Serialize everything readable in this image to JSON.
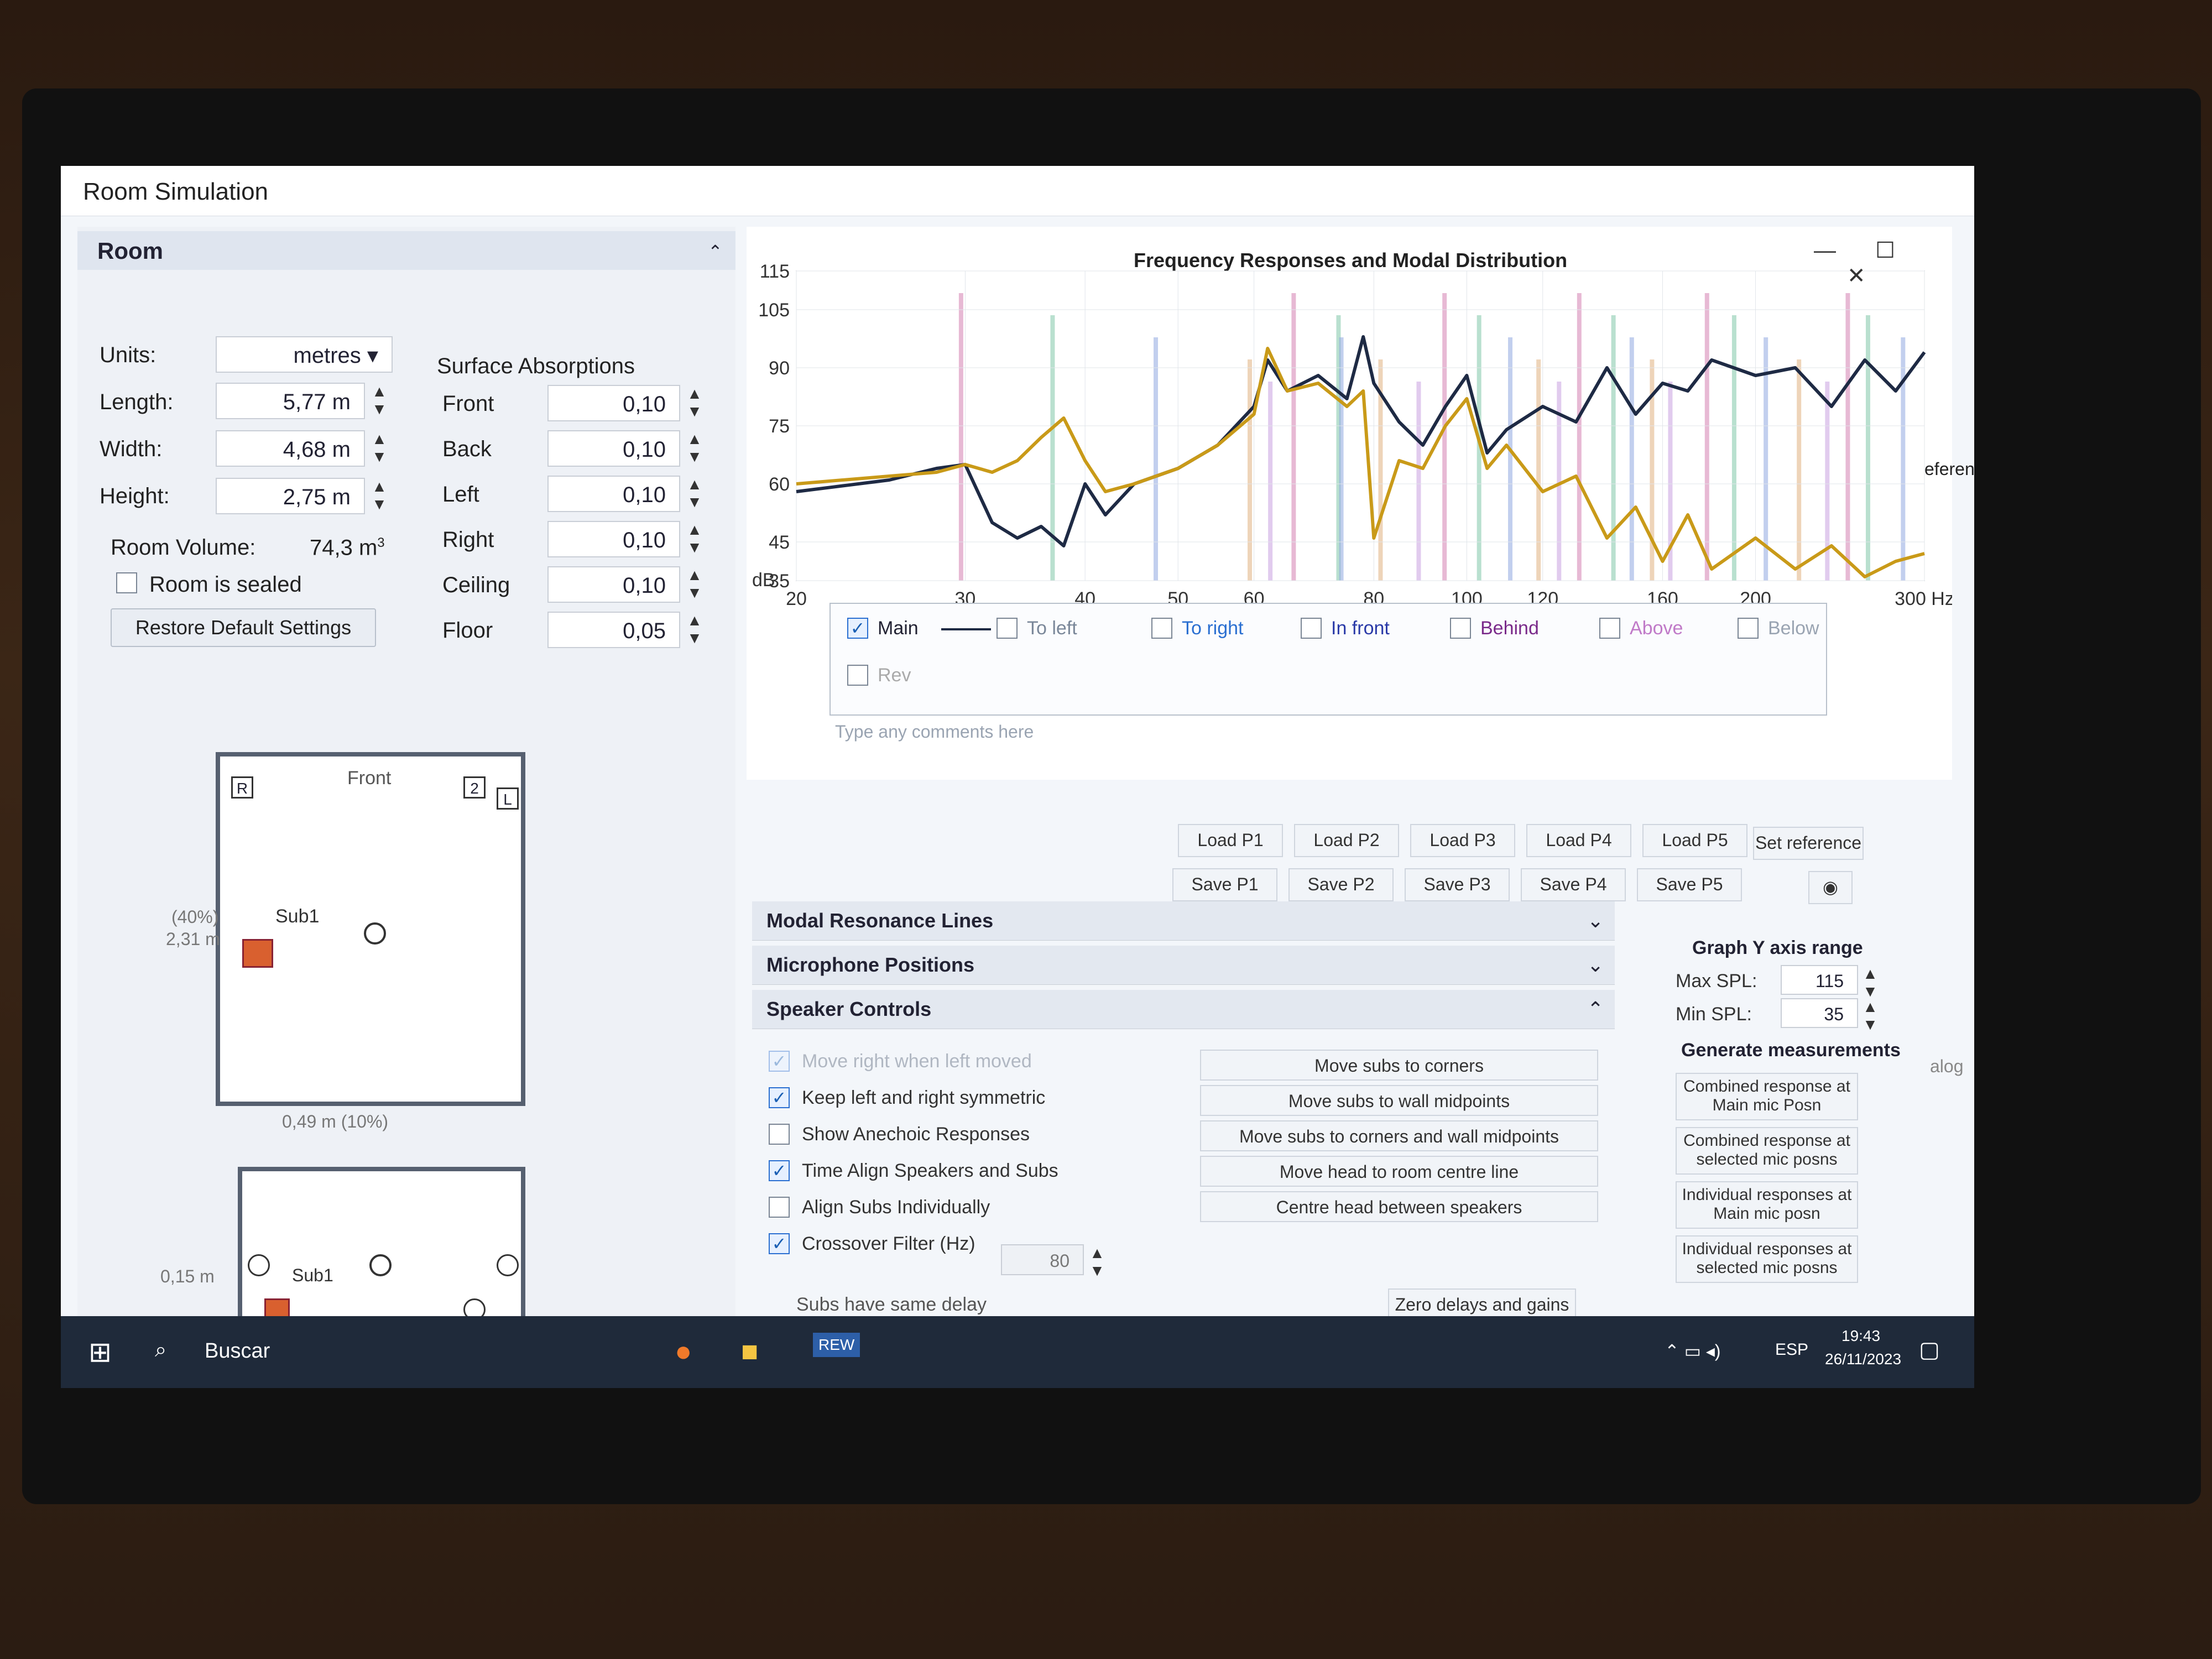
{
  "window": {
    "title": "Room Simulation"
  },
  "room": {
    "header": "Room",
    "units_label": "Units:",
    "units_value": "metres",
    "length_label": "Length:",
    "length_value": "5,77 m",
    "width_label": "Width:",
    "width_value": "4,68 m",
    "height_label": "Height:",
    "height_value": "2,75 m",
    "volume_label": "Room Volume:",
    "volume_value": "74,3 m",
    "volume_sup": "3",
    "sealed_label": "Room is sealed",
    "restore_label": "Restore Default Settings"
  },
  "absorption": {
    "title": "Surface Absorptions",
    "rows": [
      {
        "label": "Front",
        "value": "0,10"
      },
      {
        "label": "Back",
        "value": "0,10"
      },
      {
        "label": "Left",
        "value": "0,10"
      },
      {
        "label": "Right",
        "value": "0,10"
      },
      {
        "label": "Ceiling",
        "value": "0,10"
      },
      {
        "label": "Floor",
        "value": "0,05"
      }
    ]
  },
  "plan": {
    "front_label": "Front",
    "sub_label": "Sub1",
    "spk_r": "R",
    "spk_2": "2",
    "spk_l": "L",
    "y_pct": "(40%)",
    "y_dist": "2,31 m",
    "x_dist": "0,49 m (10%)",
    "z_dist": "0,15 m",
    "sub2_label": "Sub1"
  },
  "chart_data": {
    "type": "line",
    "title": "Frequency Responses and Modal Distribution",
    "ylabel": "dB",
    "yticks": [
      "115",
      "105",
      "90",
      "75",
      "60",
      "45",
      "35"
    ],
    "xticks": [
      "20",
      "30",
      "40",
      "50",
      "60",
      "80",
      "100",
      "120",
      "160",
      "200",
      "300 Hz"
    ],
    "xscale": "log",
    "xlim": [
      20,
      300
    ],
    "ylim": [
      35,
      115
    ],
    "series": [
      {
        "name": "Main",
        "color": "#1e2a44",
        "x": [
          20,
          25,
          28,
          30,
          32,
          34,
          36,
          38,
          40,
          42,
          45,
          50,
          55,
          60,
          62,
          65,
          70,
          75,
          78,
          80,
          85,
          90,
          95,
          100,
          105,
          110,
          120,
          130,
          140,
          150,
          160,
          170,
          180,
          200,
          220,
          240,
          260,
          280,
          300
        ],
        "y": [
          58,
          61,
          64,
          65,
          50,
          46,
          49,
          44,
          60,
          52,
          60,
          64,
          70,
          80,
          92,
          84,
          88,
          82,
          98,
          86,
          76,
          70,
          80,
          88,
          68,
          74,
          80,
          76,
          90,
          78,
          86,
          84,
          92,
          88,
          90,
          80,
          92,
          84,
          94
        ]
      },
      {
        "color": "#c99a18",
        "x": [
          20,
          25,
          28,
          30,
          32,
          34,
          36,
          38,
          40,
          42,
          45,
          50,
          55,
          60,
          62,
          65,
          70,
          75,
          78,
          80,
          85,
          90,
          95,
          100,
          105,
          110,
          120,
          130,
          140,
          150,
          160,
          170,
          180,
          200,
          220,
          240,
          260,
          280,
          300
        ],
        "y": [
          60,
          62,
          63,
          65,
          63,
          66,
          72,
          77,
          66,
          58,
          60,
          64,
          70,
          78,
          95,
          84,
          86,
          80,
          84,
          46,
          66,
          64,
          75,
          82,
          64,
          70,
          58,
          62,
          46,
          54,
          40,
          52,
          38,
          46,
          38,
          44,
          36,
          40,
          42
        ]
      }
    ],
    "modal_lines": [
      {
        "f": 29.7
      },
      {
        "f": 37.0
      },
      {
        "f": 47.4
      },
      {
        "f": 59.4
      },
      {
        "f": 62.4
      },
      {
        "f": 66.0
      },
      {
        "f": 73.5
      },
      {
        "f": 74.0
      },
      {
        "f": 81.3
      },
      {
        "f": 89.1
      },
      {
        "f": 94.8
      },
      {
        "f": 103.0
      },
      {
        "f": 111.0
      },
      {
        "f": 118.8
      },
      {
        "f": 124.8
      },
      {
        "f": 131.0
      },
      {
        "f": 142.2
      },
      {
        "f": 148.6
      },
      {
        "f": 156.0
      },
      {
        "f": 163.0
      },
      {
        "f": 178.0
      },
      {
        "f": 190.0
      },
      {
        "f": 205.0
      },
      {
        "f": 222.0
      },
      {
        "f": 237.6
      },
      {
        "f": 249.6
      },
      {
        "f": 262.0
      },
      {
        "f": 285.0
      }
    ],
    "legend_placement": "bottom",
    "grid": true
  },
  "legend": {
    "items": [
      "Main",
      "To left",
      "To right",
      "In front",
      "Behind",
      "Above",
      "Below",
      "Rev"
    ],
    "comment_placeholder": "Type any comments here"
  },
  "presets": {
    "load": [
      "Load P1",
      "Load P2",
      "Load P3",
      "Load P4",
      "Load P5"
    ],
    "save": [
      "Save P1",
      "Save P2",
      "Save P3",
      "Save P4",
      "Save P5"
    ],
    "set_reference": "Set reference"
  },
  "sections": {
    "modal": "Modal Resonance Lines",
    "mic": "Microphone Positions",
    "speaker": "Speaker Controls"
  },
  "speaker_controls": {
    "checks": [
      {
        "label": "Move right when left moved",
        "on": true,
        "disabled": true
      },
      {
        "label": "Keep left and right symmetric",
        "on": true
      },
      {
        "label": "Show Anechoic Responses",
        "on": false
      },
      {
        "label": "Time Align Speakers and Subs",
        "on": true
      },
      {
        "label": "Align Subs Individually",
        "on": false
      },
      {
        "label": "Crossover Filter (Hz)",
        "on": true
      }
    ],
    "crossover_value": "80",
    "subs_delay_label": "Subs have same delay",
    "buttons": [
      "Move subs to corners",
      "Move subs to wall midpoints",
      "Move subs to corners and wall midpoints",
      "Move head to room centre line",
      "Centre head between speakers"
    ],
    "zero_label": "Zero delays and gains"
  },
  "graph_range": {
    "title": "Graph Y axis range",
    "max_label": "Max SPL:",
    "max_value": "115",
    "min_label": "Min SPL:",
    "min_value": "35",
    "gen_title": "Generate measurements",
    "buttons": [
      "Combined response at Main mic Posn",
      "Combined response at selected mic posns",
      "Individual responses at Main mic posn",
      "Individual responses at selected mic posns"
    ]
  },
  "side": {
    "preferences": "eferences",
    "dialog": "alog"
  },
  "taskbar": {
    "search": "Buscar",
    "lang": "ESP",
    "time": "19:43",
    "date": "26/11/2023",
    "rew": "REW"
  }
}
